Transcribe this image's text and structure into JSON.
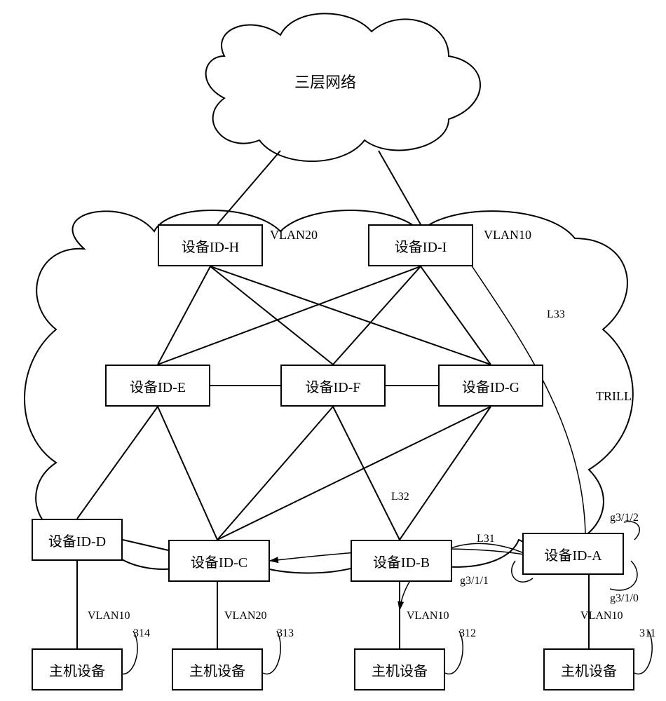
{
  "cloud_top": "三层网络",
  "trill_label": "TRILL",
  "device": {
    "H": "设备ID-H",
    "I": "设备ID-I",
    "E": "设备ID-E",
    "F": "设备ID-F",
    "G": "设备ID-G",
    "D": "设备ID-D",
    "C": "设备ID-C",
    "B": "设备ID-B",
    "A": "设备ID-A"
  },
  "host": "主机设备",
  "vlan": {
    "10": "VLAN10",
    "20": "VLAN20"
  },
  "link": {
    "L31": "L31",
    "L32": "L32",
    "L33": "L33"
  },
  "port": {
    "g310": "g3/1/0",
    "g311": "g3/1/1",
    "g312": "g3/1/2"
  },
  "ref": {
    "r311": "311",
    "r312": "312",
    "r313": "313",
    "r314": "314"
  }
}
